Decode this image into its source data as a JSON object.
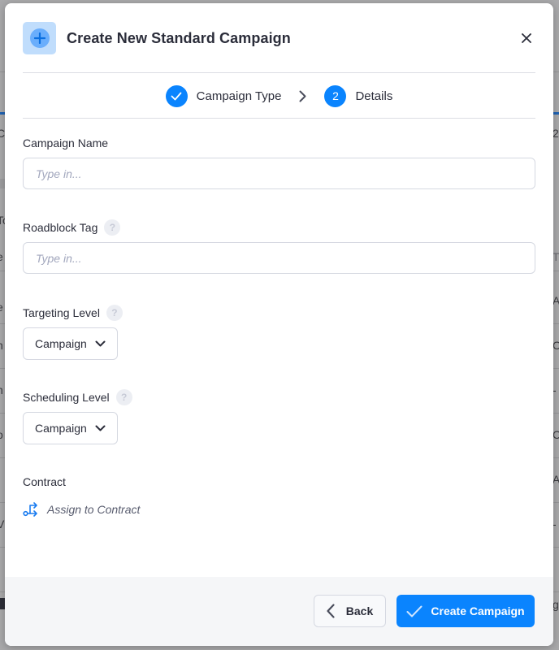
{
  "background_page": {
    "left_edge_chars": [
      "C",
      "To",
      "e",
      "e",
      "n",
      "n",
      "o",
      "",
      "V"
    ],
    "right_edge_chars": [
      "2",
      "T",
      "A",
      "C",
      "-",
      "C",
      "A",
      "-",
      "g"
    ]
  },
  "modal": {
    "title": "Create New Standard Campaign",
    "header_icon": "plus-icon",
    "close_icon": "close-icon",
    "stepper": {
      "steps": [
        {
          "label": "Campaign Type",
          "state": "completed",
          "marker": "✓"
        },
        {
          "label": "Details",
          "state": "current",
          "marker": "2"
        }
      ]
    },
    "fields": {
      "campaign_name": {
        "label": "Campaign Name",
        "value": "",
        "placeholder": "Type in..."
      },
      "roadblock_tag": {
        "label": "Roadblock Tag",
        "value": "",
        "placeholder": "Type in...",
        "help": "?"
      },
      "targeting_level": {
        "label": "Targeting Level",
        "selected": "Campaign",
        "help": "?"
      },
      "scheduling_level": {
        "label": "Scheduling Level",
        "selected": "Campaign",
        "help": "?"
      },
      "contract": {
        "label": "Contract",
        "link_label": "Assign to Contract"
      }
    },
    "footer": {
      "back_label": "Back",
      "create_label": "Create Campaign"
    }
  },
  "colors": {
    "accent": "#0a84fe",
    "header_icon_bg": "#c0ddfc",
    "text": "#2b2d3a",
    "placeholder": "#a2a7bd",
    "footer_bg": "#f5f6f8"
  }
}
